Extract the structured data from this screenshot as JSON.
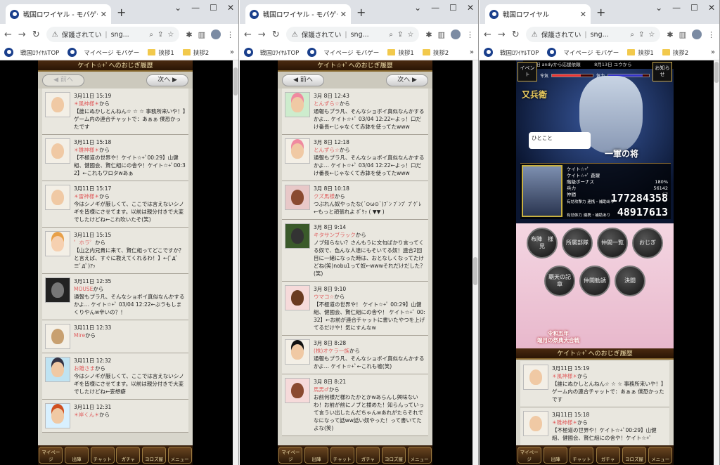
{
  "windows": [
    {
      "tab_title": "戦国ロワイヤル - モバゲー",
      "url_warning": "保護されてい",
      "url_domain": "sng...",
      "bookmarks": [
        "戦国ﾛﾜｲﾔﾙTOP",
        "マイページ モバゲー",
        "挟拶1",
        "挟拶2"
      ],
      "header": "ケイト☆+ﾟへのおじぎ履歴",
      "prev": "前へ",
      "next": "次へ",
      "messages": [
        {
          "date": "3月11日 15:19",
          "from": "☀風神様☀",
          "body": "【誰にぬかしとんねん☆ ☆ ☆ 事務所来いや！】ゲーム内の連合チャットで：あぁぁ 僕恐かったです"
        },
        {
          "date": "3月11日 15:18",
          "from": "☀雛神様☀",
          "body": "【不極道の世界や！ケイト☆+ﾟ00:29】山健組、健國会、賢仁組にの舎や！ケイト☆+ﾟ00:32】←これもワロタwあぁ"
        },
        {
          "date": "3月11日 15:17",
          "from": "☀雷神様☀",
          "body": "今はシノギが厳しくて、ここでは言えないシノギを皆様にさせてます。以前は親分付きで大変でしたけどね←これ吹いたぞ(笑)"
        },
        {
          "date": "3月11日 15:15",
          "from": "゜ホラ゜",
          "body": "【山之内兄貴に来て、賢仁組ってどこですか？と言えば、すぐに教えてくれるわ！】←(ﾟдﾟ≡ﾟдﾟ)ｱｯ"
        },
        {
          "date": "3月11日 12:35",
          "from": "MOUSE",
          "body": "通報もプラ凡、そんなショボイ真似なんかするかよ… ケイト☆+ﾟ 03/04 12:22←ぶラもしまくりやんw辛いの？！"
        },
        {
          "date": "3月11日 12:33",
          "from": "Mire",
          "body": ""
        },
        {
          "date": "3月11日 12:32",
          "from": "お雛さま",
          "body": "今はシノギが厳しくて、ここでは言えないシノギを皆様にさせてます。以前は親分付きで大変でしたけどね←妄想癖"
        },
        {
          "date": "3月11日 12:31",
          "from": "☀岸くん☀",
          "body": ""
        }
      ],
      "nav": [
        "マイページ",
        "出陣",
        "チャット",
        "ガチャ",
        "ヨロズ屋",
        "メニュー"
      ]
    },
    {
      "tab_title": "戦国ロワイヤル - モバゲー",
      "url_warning": "保護されてい",
      "url_domain": "sng...",
      "bookmarks": [
        "戦国ﾛﾜｲﾔﾙTOP",
        "マイページ モバゲー",
        "挟拶1",
        "挟拶2"
      ],
      "header": "ケイト☆+ﾟへのおじぎ履歴",
      "prev": "前へ",
      "next": "次へ",
      "messages": [
        {
          "date": "3月 8日 12:43",
          "from": "とんずら☆",
          "body": "通報もプラ凡、そんなショボイ真似なんかするかよ… ケイト☆+ﾟ 03/04 12:22←よっ！口だけ番長←じゃなくて赤鉢を使ってたwww"
        },
        {
          "date": "3月 8日 12:18",
          "from": "とんずら☆",
          "body": "通報もプラ凡、そんなショボイ真似なんかするかよ… ケイト☆+ﾟ 03/04 12:22←よっ！口だけ番長←じゃなくて赤鉢を使ってたwww"
        },
        {
          "date": "3月 8日 10:18",
          "from": "クズ馬様",
          "body": "つぶれん奴やったな(´⊙ω⊙`)ﾌﾞﾝ ﾌﾞﾝﾌﾟ ﾌﾟｹﾞﾚ←もっと頑張れよ ﾎﾞｹｯ ( ▼▼ )"
        },
        {
          "date": "3月 8日 9:14",
          "from": "キタサンブラック",
          "body": "ノブ知らない？さんもうに文句ばかり言ってくる奴で、色んな人達にもそいてる奴！連合2回目に一緒になった時は、おとなしくなってたけどね(笑)nobu1って奴←wwwそれだけだした？(笑)"
        },
        {
          "date": "3月 8日 9:10",
          "from": "ウマコ☆",
          "body": "【不極道の世界や！ ケイト☆+ﾟ 00:29】山健組、健國会、賢仁組にの舎や！ ケイト☆+ﾟ 00:32】←お前が連合チャットに書いたやつを上げてるだけや！気にすんなw"
        },
        {
          "date": "3月 8日 8:28",
          "from": "(株)オケラ一族",
          "body": "通報もプラ凡、そんなショボイ真似なんかするかよ… ケイト☆+ﾟ←これも嘘(笑)"
        },
        {
          "date": "3月 8日 8:21",
          "from": "馬男♂",
          "body": "お前何様だ様わたかとかwあらんし興味ないわ！お前が前にノブと揉めた！知らんっていって言うい出したんだちゃんwあれがたらそれでなになって話ww話い奴やった！って書いてたよな(笑)"
        }
      ],
      "nav": [
        "マイページ",
        "出陣",
        "チャット",
        "ガチャ",
        "ヨロズ屋",
        "メニュー"
      ]
    },
    {
      "tab_title": "戦国ロワイヤル",
      "url_warning": "保護されてい",
      "url_domain": "sng...",
      "bookmarks": [
        "戦国ﾛﾜｲﾔﾙTOP",
        "マイページ モバゲー",
        "挟拶1",
        "挟拶2"
      ],
      "banner": "旧 andyから応援依頼",
      "banner_date": "8月13日 ユウから",
      "event_btn": "イベント",
      "notice_btn": "お知らせ",
      "hero_title": "又兵衛",
      "hitokoto": "ひとこと",
      "rank_title": "一軍の将",
      "stats": {
        "name": "ケイト☆+ﾟ",
        "sub": "ケイト☆+ﾟ 蒼躍",
        "row1_label": "階級ボーナス",
        "row1_val": "180%",
        "row2_label": "兵力",
        "row2_val": "56142",
        "row3_label": "仲間",
        "row3_val": "67",
        "attack_label": "有効攻撃力 連携・補助あり",
        "attack": "177284358",
        "defense_label": "有効体力 連携・補助あり",
        "defense": "48917613"
      },
      "menu": [
        "布陣　様見",
        "所属部隊",
        "仲間一覧",
        "おじぎ",
        "覇天の記章",
        "仲間勧誘",
        "決闘"
      ],
      "menu_banner": "令和五年\n端月の祭典大合戦",
      "header": "ケイト☆+ﾟへのおじぎ履歴",
      "messages": [
        {
          "date": "3月11日 15:19",
          "from": "☀風神様☀",
          "body": "【誰にぬかしとんねん☆ ☆ ☆ 事務所来いや！】ゲーム内の連合チャットで：あぁぁ 僕恐かったです"
        },
        {
          "date": "3月11日 15:18",
          "from": "☀雛神様☀",
          "body": "【不極道の世界や！ケイト☆+ﾟ00:29】山健組、健國会、賢仁組にの舎や！ケイト☆+ﾟ"
        }
      ],
      "nav": [
        "マイページ",
        "出陣",
        "チャット",
        "ガチャ",
        "ヨロズ屋",
        "メニュー"
      ]
    }
  ],
  "colors": {
    "from_name": "#e06060",
    "panel": "#d8d6cc",
    "header_bg": "#3a200c"
  }
}
